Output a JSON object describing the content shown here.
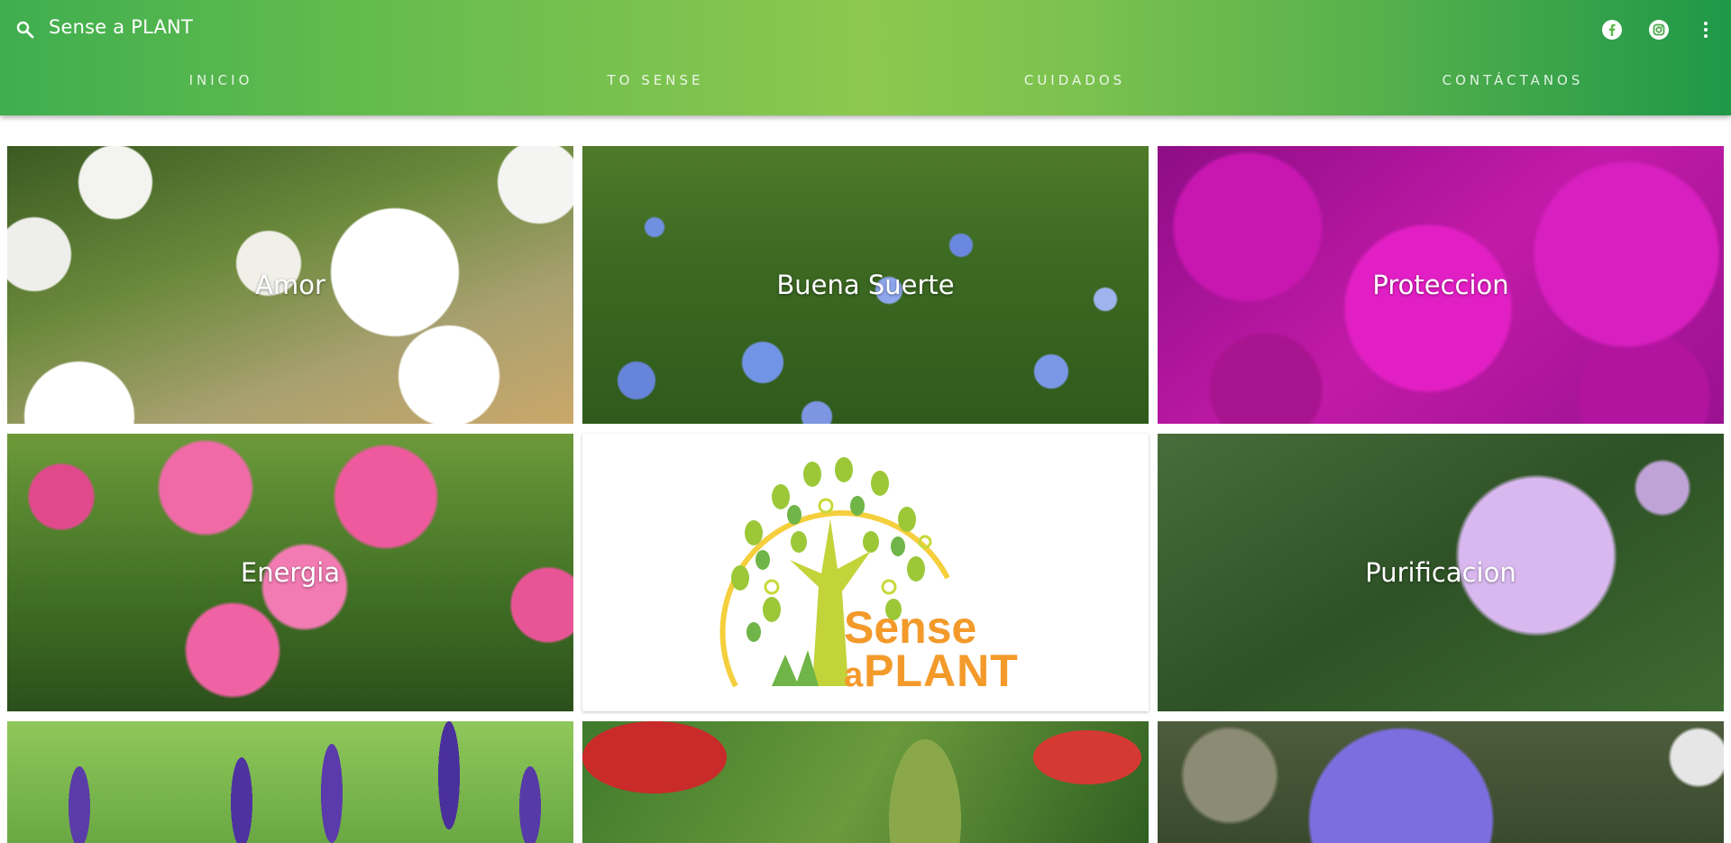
{
  "header": {
    "title": "Sense a PLANT",
    "tabs": [
      {
        "label": "INICIO"
      },
      {
        "label": "TO SENSE"
      },
      {
        "label": "CUIDADOS"
      },
      {
        "label": "CONTÁCTANOS"
      }
    ],
    "icons": [
      "search-icon",
      "facebook-icon",
      "instagram-icon",
      "more-vert-icon"
    ]
  },
  "grid": {
    "tiles": [
      {
        "label": "Amor"
      },
      {
        "label": "Buena Suerte"
      },
      {
        "label": "Proteccion"
      },
      {
        "label": "Energia"
      },
      {
        "label": "Purificacion"
      }
    ],
    "logo": {
      "line1": "Sense",
      "line2_small": "a",
      "line2": "PLANT"
    }
  },
  "colors": {
    "header_green": "#62bb4d",
    "logo_orange": "#f39a2a",
    "logo_green": "#9cc838"
  }
}
